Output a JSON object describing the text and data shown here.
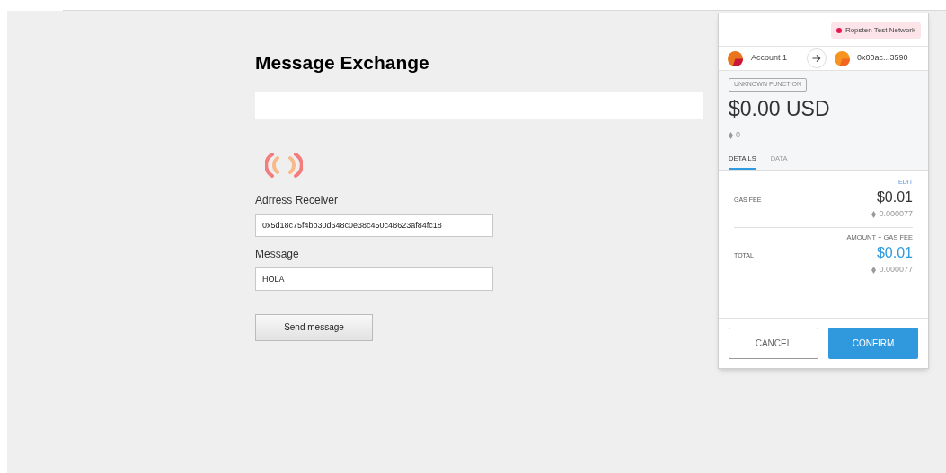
{
  "page": {
    "title": "Message Exchange",
    "fields": [
      {
        "label": "Adrress Receiver",
        "value": "0x5d18c75f4bb30d648c0e38c450c48623af84fc18"
      },
      {
        "label": "Message",
        "value": "HOLA"
      }
    ],
    "button": "Send message"
  },
  "popup": {
    "network": {
      "name": "Ropsten Test Network",
      "color": "#e91550"
    },
    "from": "Account 1",
    "to": "0x00ac...3590",
    "function": "UNKNOWN FUNCTION",
    "amount": "$0.00 USD",
    "eth": "0",
    "tabs": [
      {
        "label": "DETAILS",
        "selected": true
      },
      {
        "label": "DATA",
        "selected": false
      }
    ],
    "edit": "EDIT",
    "rows": [
      {
        "label": "GAS FEE",
        "caption": "",
        "usd": "$0.01",
        "eth": "0.000077",
        "kind": "plain"
      },
      {
        "label": "TOTAL",
        "caption": "AMOUNT + GAS FEE",
        "usd": "$0.01",
        "eth": "0.000077",
        "kind": "total"
      }
    ],
    "cancel": "CANCEL",
    "confirm": "CONFIRM"
  }
}
